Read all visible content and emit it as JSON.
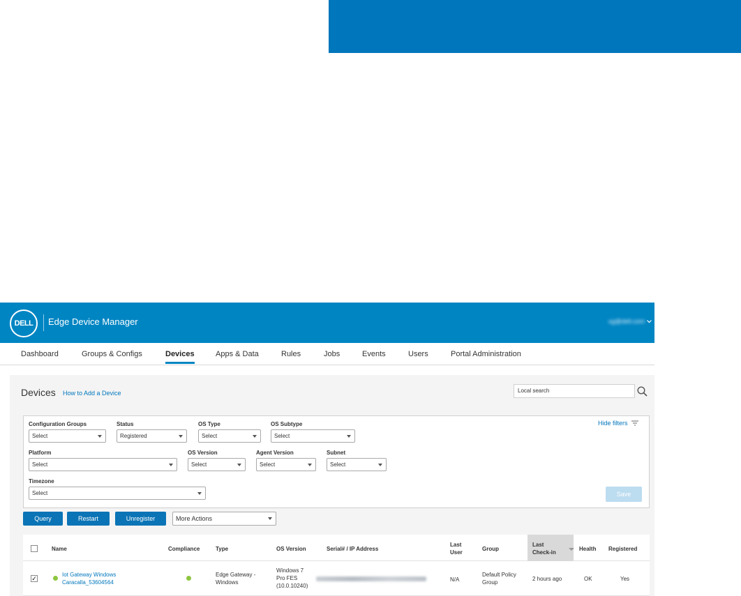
{
  "app": {
    "logo_text": "DELL",
    "title": "Edge Device Manager",
    "user": "xg@dell.com"
  },
  "nav": {
    "items": [
      "Dashboard",
      "Groups & Configs",
      "Devices",
      "Apps & Data",
      "Rules",
      "Jobs",
      "Events",
      "Users",
      "Portal Administration"
    ],
    "active": "Devices"
  },
  "page": {
    "title": "Devices",
    "how_to_link": "How to Add a Device",
    "search_placeholder": "Local search"
  },
  "filters": {
    "hide_label": "Hide filters",
    "config_groups": {
      "label": "Configuration Groups",
      "value": "Select"
    },
    "status": {
      "label": "Status",
      "value": "Registered"
    },
    "os_type": {
      "label": "OS Type",
      "value": "Select"
    },
    "os_subtype": {
      "label": "OS Subtype",
      "value": "Select"
    },
    "platform": {
      "label": "Platform",
      "value": "Select"
    },
    "os_version": {
      "label": "OS Version",
      "value": "Select"
    },
    "agent_version": {
      "label": "Agent Version",
      "value": "Select"
    },
    "subnet": {
      "label": "Subnet",
      "value": "Select"
    },
    "timezone": {
      "label": "Timezone",
      "value": "Select"
    },
    "save_label": "Save"
  },
  "actions": {
    "query": "Query",
    "restart": "Restart",
    "unregister": "Unregister",
    "more_actions": "More Actions"
  },
  "table": {
    "columns": {
      "name": "Name",
      "compliance": "Compliance",
      "type": "Type",
      "os_version": "OS Version",
      "serial_ip": "Serial# / IP Address",
      "last_user_1": "Last",
      "last_user_2": "User",
      "group": "Group",
      "last_checkin_1": "Last",
      "last_checkin_2": "Check-in",
      "health": "Health",
      "registered": "Registered"
    },
    "rows": [
      {
        "checked": "✓",
        "name_1": "Iot Gateway Windows",
        "name_2": "Caracalla_53604564",
        "type_1": "Edge Gateway -",
        "type_2": "Windows",
        "os_1": "Windows 7",
        "os_2": "Pro FES",
        "os_3": "(10.0.10240)",
        "last_user": "N/A",
        "group_1": "Default Policy",
        "group_2": "Group",
        "last_checkin": "2 hours ago",
        "health": "OK",
        "registered": "Yes"
      }
    ]
  },
  "colors": {
    "brand_blue": "#0085c3",
    "button_blue": "#0a74b6",
    "status_green": "#8dc63f"
  }
}
